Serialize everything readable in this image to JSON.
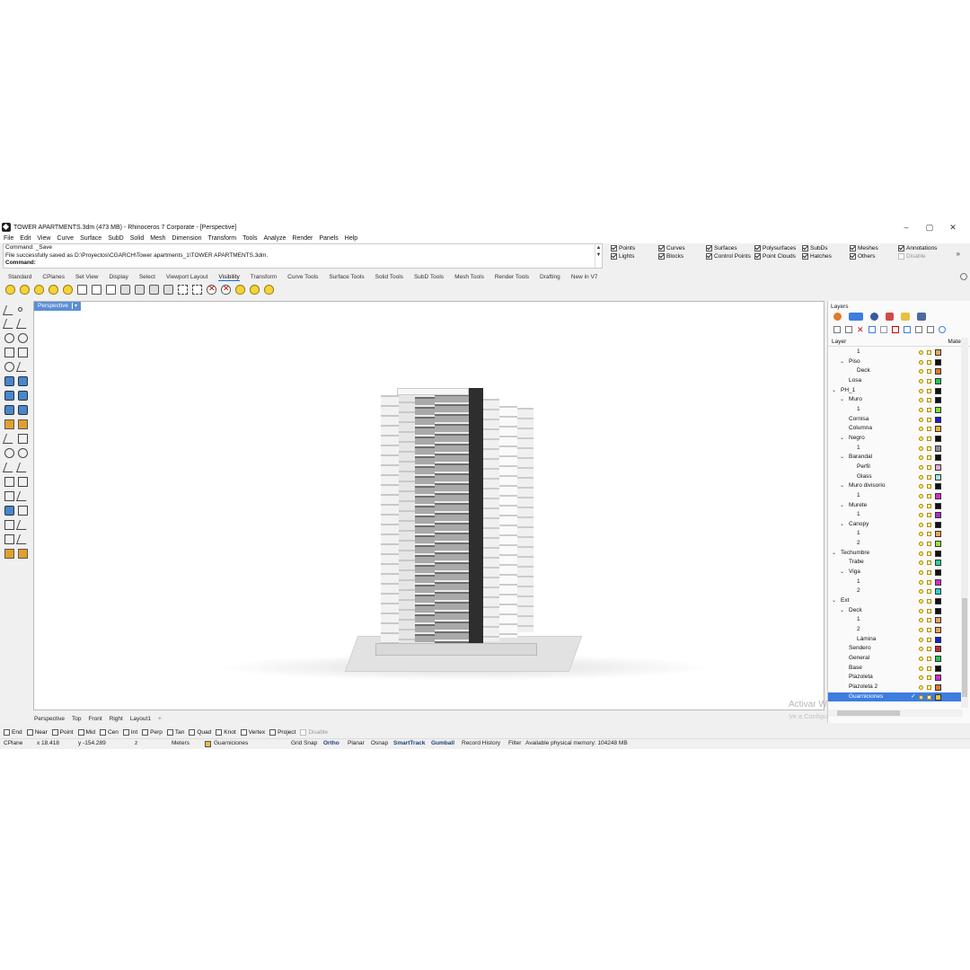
{
  "window": {
    "title": "TOWER APARTMENTS.3dm (473 MB) - Rhinoceros 7 Corporate - [Perspective]",
    "controls": [
      "–",
      "▢",
      "✕"
    ]
  },
  "menu": [
    "File",
    "Edit",
    "View",
    "Curve",
    "Surface",
    "SubD",
    "Solid",
    "Mesh",
    "Dimension",
    "Transform",
    "Tools",
    "Analyze",
    "Render",
    "Panels",
    "Help"
  ],
  "command": {
    "history": [
      "Command: _Save",
      "File successfully saved as D:\\Proyectos\\CGARCH\\Tower apartments_1\\TOWER APARTMENTS.3dm."
    ],
    "prompt": "Command:"
  },
  "filters": [
    {
      "label": "Points",
      "checked": true
    },
    {
      "label": "Lights",
      "checked": true
    },
    {
      "label": "Curves",
      "checked": true
    },
    {
      "label": "Blocks",
      "checked": true
    },
    {
      "label": "Surfaces",
      "checked": true
    },
    {
      "label": "Control Points",
      "checked": true
    },
    {
      "label": "Polysurfaces",
      "checked": true
    },
    {
      "label": "Point Clouds",
      "checked": true
    },
    {
      "label": "SubDs",
      "checked": true
    },
    {
      "label": "Hatches",
      "checked": true
    },
    {
      "label": "Meshes",
      "checked": true
    },
    {
      "label": "Others",
      "checked": true
    },
    {
      "label": "Annotations",
      "checked": true
    },
    {
      "label": "Disable",
      "checked": false
    }
  ],
  "filters_more": "»",
  "tabs": [
    "Standard",
    "CPlanes",
    "Set View",
    "Display",
    "Select",
    "Viewport Layout",
    "Visibility",
    "Transform",
    "Curve Tools",
    "Surface Tools",
    "Solid Tools",
    "SubD Tools",
    "Mesh Tools",
    "Render Tools",
    "Drafting",
    "New in V7"
  ],
  "active_tab": "Visibility",
  "viewport": {
    "label": "Perspective",
    "dropdown": "▾"
  },
  "view_tabs": [
    "Perspective",
    "Top",
    "Front",
    "Right",
    "Layout1"
  ],
  "view_tab_add": "+",
  "watermark": {
    "line1": "Activar Windows",
    "line2": "Ve a Configuración para activar Windows."
  },
  "layers_panel": {
    "title": "Layers",
    "col_layer": "Layer",
    "col_material": "Mater",
    "rows": [
      {
        "name": "1",
        "indent": 2,
        "chev": "",
        "color": "#e8a25a"
      },
      {
        "name": "Piso",
        "indent": 1,
        "chev": "⌄",
        "color": "#111111"
      },
      {
        "name": "Deck",
        "indent": 2,
        "chev": "",
        "color": "#e8742a"
      },
      {
        "name": "Losa",
        "indent": 1,
        "chev": "",
        "color": "#22c65a"
      },
      {
        "name": "PH_1",
        "indent": 0,
        "chev": "⌄",
        "color": "#111111"
      },
      {
        "name": "Muro",
        "indent": 1,
        "chev": "⌄",
        "color": "#111111"
      },
      {
        "name": "1",
        "indent": 2,
        "chev": "",
        "color": "#7ee03a"
      },
      {
        "name": "Cornisa",
        "indent": 1,
        "chev": "",
        "color": "#1a22c8"
      },
      {
        "name": "Columna",
        "indent": 1,
        "chev": "",
        "color": "#f0b02a"
      },
      {
        "name": "Negro",
        "indent": 1,
        "chev": "⌄",
        "color": "#111111"
      },
      {
        "name": "1",
        "indent": 2,
        "chev": "",
        "color": "#8f8f8f"
      },
      {
        "name": "Barandal",
        "indent": 1,
        "chev": "⌄",
        "color": "#111111"
      },
      {
        "name": "Perfil",
        "indent": 2,
        "chev": "",
        "color": "#f5a6d6"
      },
      {
        "name": "Glass",
        "indent": 2,
        "chev": "",
        "color": "#9ee8e0"
      },
      {
        "name": "Muro divisorio",
        "indent": 1,
        "chev": "⌄",
        "color": "#111111"
      },
      {
        "name": "1",
        "indent": 2,
        "chev": "",
        "color": "#d62ad0"
      },
      {
        "name": "Murete",
        "indent": 1,
        "chev": "⌄",
        "color": "#111111"
      },
      {
        "name": "1",
        "indent": 2,
        "chev": "",
        "color": "#b02ad0"
      },
      {
        "name": "Canopy",
        "indent": 1,
        "chev": "⌄",
        "color": "#111111"
      },
      {
        "name": "1",
        "indent": 2,
        "chev": "",
        "color": "#e8a25a"
      },
      {
        "name": "2",
        "indent": 2,
        "chev": "",
        "color": "#9ee03a"
      },
      {
        "name": "Techumbre",
        "indent": 0,
        "chev": "⌄",
        "color": "#111111"
      },
      {
        "name": "Trabe",
        "indent": 1,
        "chev": "",
        "color": "#2ad0a0"
      },
      {
        "name": "Viga",
        "indent": 1,
        "chev": "⌄",
        "color": "#111111"
      },
      {
        "name": "1",
        "indent": 2,
        "chev": "",
        "color": "#d62ad0"
      },
      {
        "name": "2",
        "indent": 2,
        "chev": "",
        "color": "#2ad0d8"
      },
      {
        "name": "Ext",
        "indent": 0,
        "chev": "⌄",
        "color": "#111111"
      },
      {
        "name": "Deck",
        "indent": 1,
        "chev": "⌄",
        "color": "#111111"
      },
      {
        "name": "1",
        "indent": 2,
        "chev": "",
        "color": "#e8a25a"
      },
      {
        "name": "2",
        "indent": 2,
        "chev": "",
        "color": "#e8a25a"
      },
      {
        "name": "Lámina",
        "indent": 2,
        "chev": "",
        "color": "#1a22c8"
      },
      {
        "name": "Sendero",
        "indent": 1,
        "chev": "",
        "color": "#c82a2a"
      },
      {
        "name": "General",
        "indent": 1,
        "chev": "",
        "color": "#22c65a"
      },
      {
        "name": "Base",
        "indent": 1,
        "chev": "",
        "color": "#111111"
      },
      {
        "name": "Plazoleta",
        "indent": 1,
        "chev": "",
        "color": "#d62ad0"
      },
      {
        "name": "Plazoleta 2",
        "indent": 1,
        "chev": "",
        "color": "#e8742a"
      },
      {
        "name": "Guarniciones",
        "indent": 1,
        "chev": "",
        "color": "#e8c040",
        "selected": true,
        "check": "✓"
      }
    ]
  },
  "osnaps": [
    {
      "label": "End",
      "checked": false
    },
    {
      "label": "Near",
      "checked": false
    },
    {
      "label": "Point",
      "checked": false
    },
    {
      "label": "Mid",
      "checked": false
    },
    {
      "label": "Cen",
      "checked": false
    },
    {
      "label": "Int",
      "checked": false
    },
    {
      "label": "Perp",
      "checked": false
    },
    {
      "label": "Tan",
      "checked": false
    },
    {
      "label": "Quad",
      "checked": false
    },
    {
      "label": "Knot",
      "checked": false
    },
    {
      "label": "Vertex",
      "checked": false
    },
    {
      "label": "Project",
      "checked": false
    },
    {
      "label": "Disable",
      "checked": false,
      "disabled": true
    }
  ],
  "status": {
    "cplane": "CPlane",
    "x": "x 18.418",
    "y": "y -154.289",
    "z": "z",
    "units": "Meters",
    "layer": "Guarniciones",
    "grid_snap": "Grid Snap",
    "ortho": "Ortho",
    "planar": "Planar",
    "osnap": "Osnap",
    "smarttrack": "SmartTrack",
    "gumball": "Gumball",
    "record_history": "Record History",
    "filter": "Filter",
    "memory": "Available physical memory: 104248 MB"
  }
}
